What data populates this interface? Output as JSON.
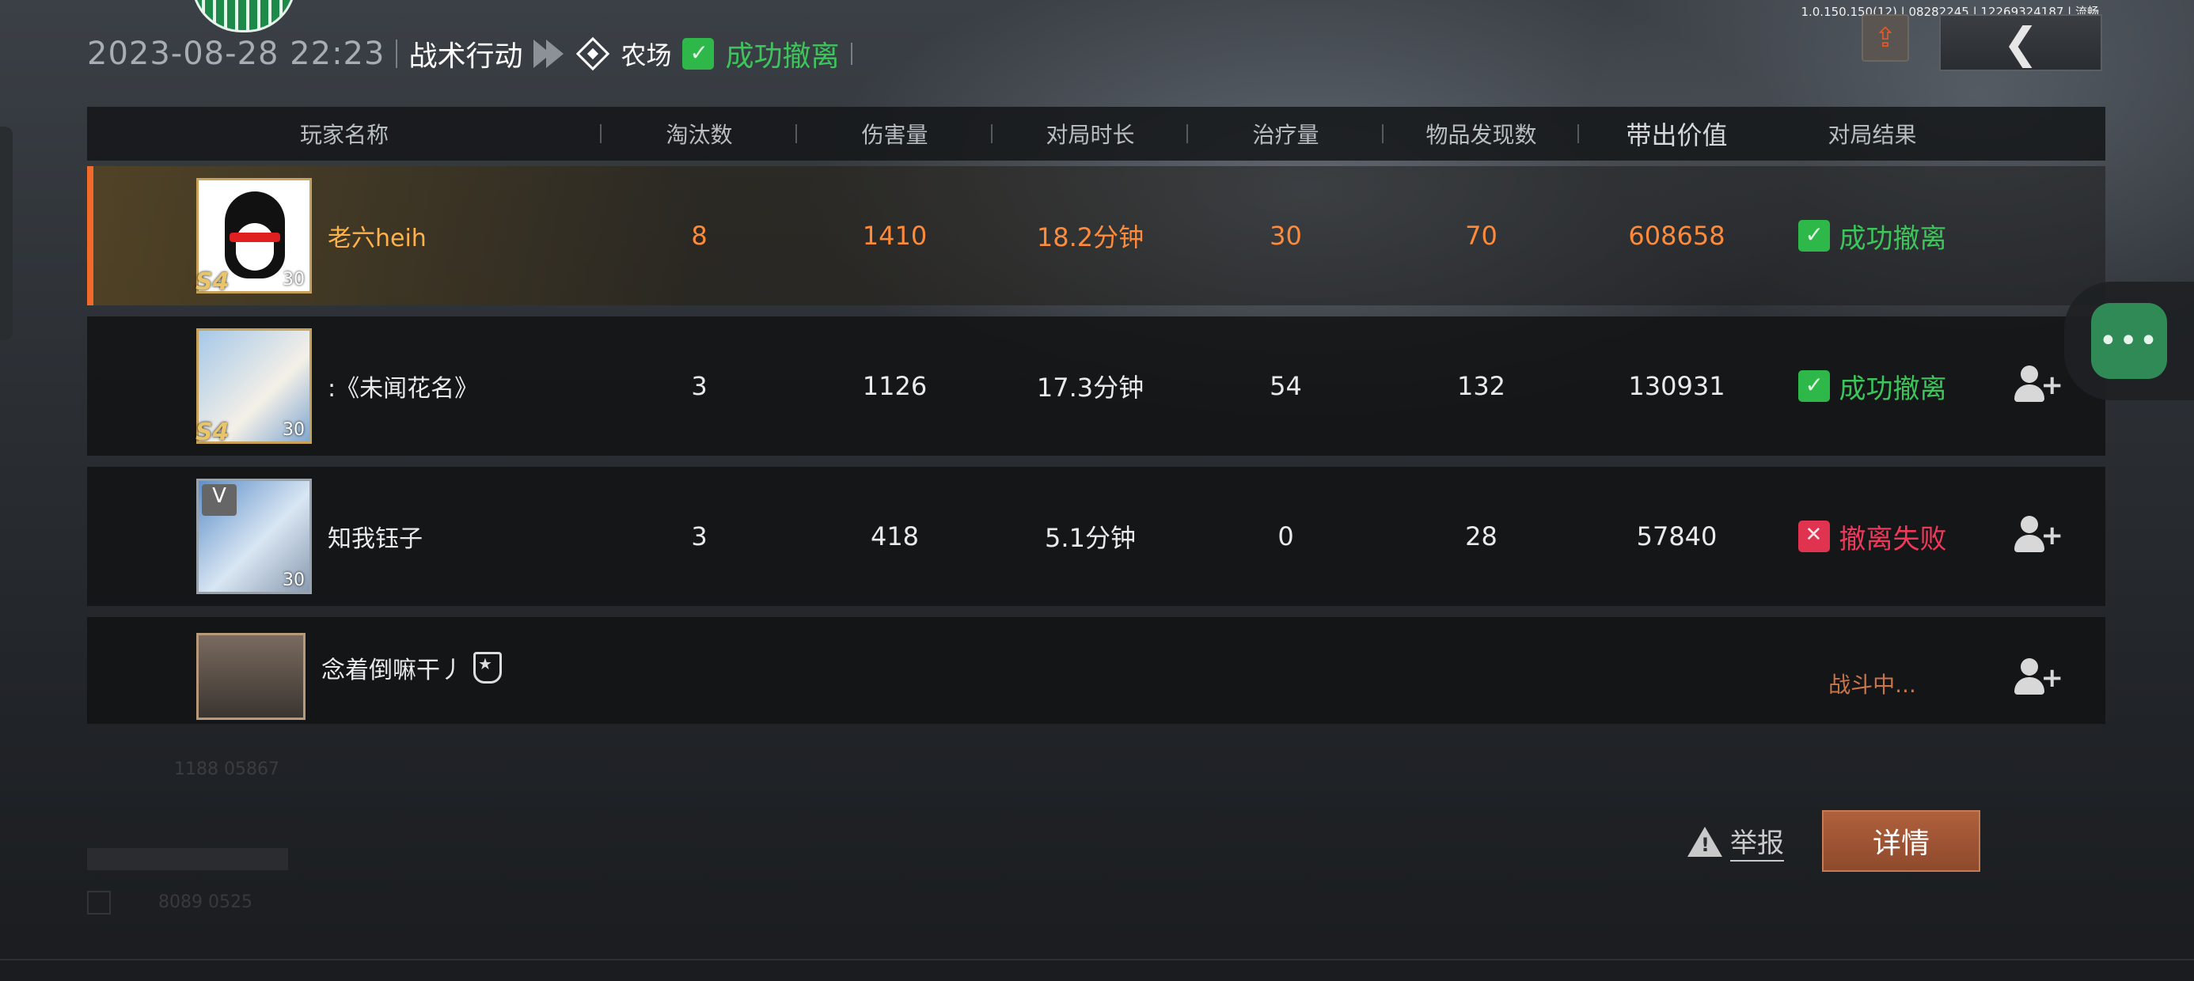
{
  "status_line": "1.0.150.150(12) | 08282245 | 12269324187 | 流畅",
  "header": {
    "datetime": "2023-08-28 22:23",
    "mode": "战术行动",
    "map": "农场",
    "result": "成功撤离"
  },
  "columns": {
    "player": "玩家名称",
    "kills": "淘汰数",
    "damage": "伤害量",
    "duration": "对局时长",
    "heal": "治疗量",
    "items": "物品发现数",
    "value": "带出价值",
    "result": "对局结果"
  },
  "players": [
    {
      "name": "老六heih",
      "level": "30",
      "season": "S4",
      "kills": "8",
      "damage": "1410",
      "duration": "18.2分钟",
      "heal": "30",
      "items": "70",
      "value": "608658",
      "result": "成功撤离",
      "status": "success"
    },
    {
      "name": ":《未闻花名》",
      "level": "30",
      "season": "S4",
      "kills": "3",
      "damage": "1126",
      "duration": "17.3分钟",
      "heal": "54",
      "items": "132",
      "value": "130931",
      "result": "成功撤离",
      "status": "success"
    },
    {
      "name": "知我钰子",
      "level": "30",
      "rank": "V",
      "kills": "3",
      "damage": "418",
      "duration": "5.1分钟",
      "heal": "0",
      "items": "28",
      "value": "57840",
      "result": "撤离失败",
      "status": "fail"
    },
    {
      "name": "念着倒嘛干丿",
      "kills": "",
      "damage": "",
      "duration": "",
      "heal": "",
      "items": "",
      "value": "",
      "result": "战斗中...",
      "status": "fighting"
    }
  ],
  "faint_text": {
    "a": "1188 05867",
    "b": "8089 0525"
  },
  "actions": {
    "report": "举报",
    "details": "详情"
  },
  "colors": {
    "accent_orange": "#f06a2a",
    "success_green": "#3dc55b",
    "fail_red": "#f0385a",
    "detail_button": "#a0583a"
  }
}
